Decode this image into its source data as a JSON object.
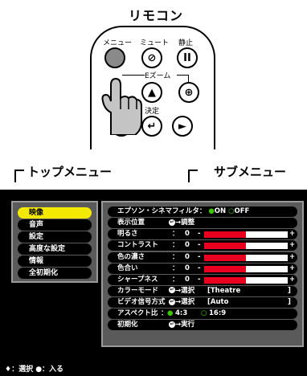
{
  "remote": {
    "title": "リモコン",
    "menu_label": "メニュー",
    "mute_label": "ミュート",
    "freeze_label": "静止",
    "ezoom_label": "Eズーム",
    "enter_label": "決定",
    "mute_glyph": "⊘",
    "freeze_glyph": "II",
    "up_glyph": "▲",
    "plus_glyph": "⊕",
    "left_glyph": "◄",
    "enter_glyph": "↵",
    "right_glyph": "►"
  },
  "labels": {
    "top_menu": "トップメニュー",
    "sub_menu": "サブメニュー"
  },
  "top_menu": {
    "items": [
      "映像",
      "音声",
      "設定",
      "高度な設定",
      "情報",
      "全初期化"
    ],
    "selected_index": 0,
    "selected_color": "#f2e800"
  },
  "sub_menu": {
    "cinema_filter": {
      "label": "エプソン・シネマフィルタ：",
      "on": "ON",
      "off": "OFF"
    },
    "position": {
      "label": "表示位置",
      "action": "調整"
    },
    "brightness": {
      "label": "明るさ",
      "sep": "：",
      "value": "0",
      "level_fraction": 0.5
    },
    "contrast": {
      "label": "コントラスト",
      "sep": "：",
      "value": "0",
      "level_fraction": 0.5
    },
    "color_sat": {
      "label": "色の濃さ",
      "sep": "：",
      "value": "0",
      "level_fraction": 0.5
    },
    "tint": {
      "label": "色合い",
      "sep": "：",
      "value": "0",
      "level_fraction": 0.5
    },
    "sharpness": {
      "label": "シャープネス",
      "sep": "：",
      "value": "0",
      "level_fraction": 0.5
    },
    "color_mode": {
      "label": "カラーモード",
      "action": "選択",
      "value": "[Theatre",
      "close": "]"
    },
    "video_signal": {
      "label": "ビデオ信号方式",
      "action": "選択",
      "value": "[Auto",
      "close": "]"
    },
    "aspect": {
      "label": "アスペクト比",
      "sep": "：",
      "opt1": "4:3",
      "opt2": "16:9"
    },
    "reset": {
      "label": "初期化",
      "action": "実行"
    },
    "bar_minus": "-",
    "bar_plus": "+",
    "bar_color": "#e8001e"
  },
  "status_bar": {
    "text": "♦：選択 ●：入る"
  }
}
